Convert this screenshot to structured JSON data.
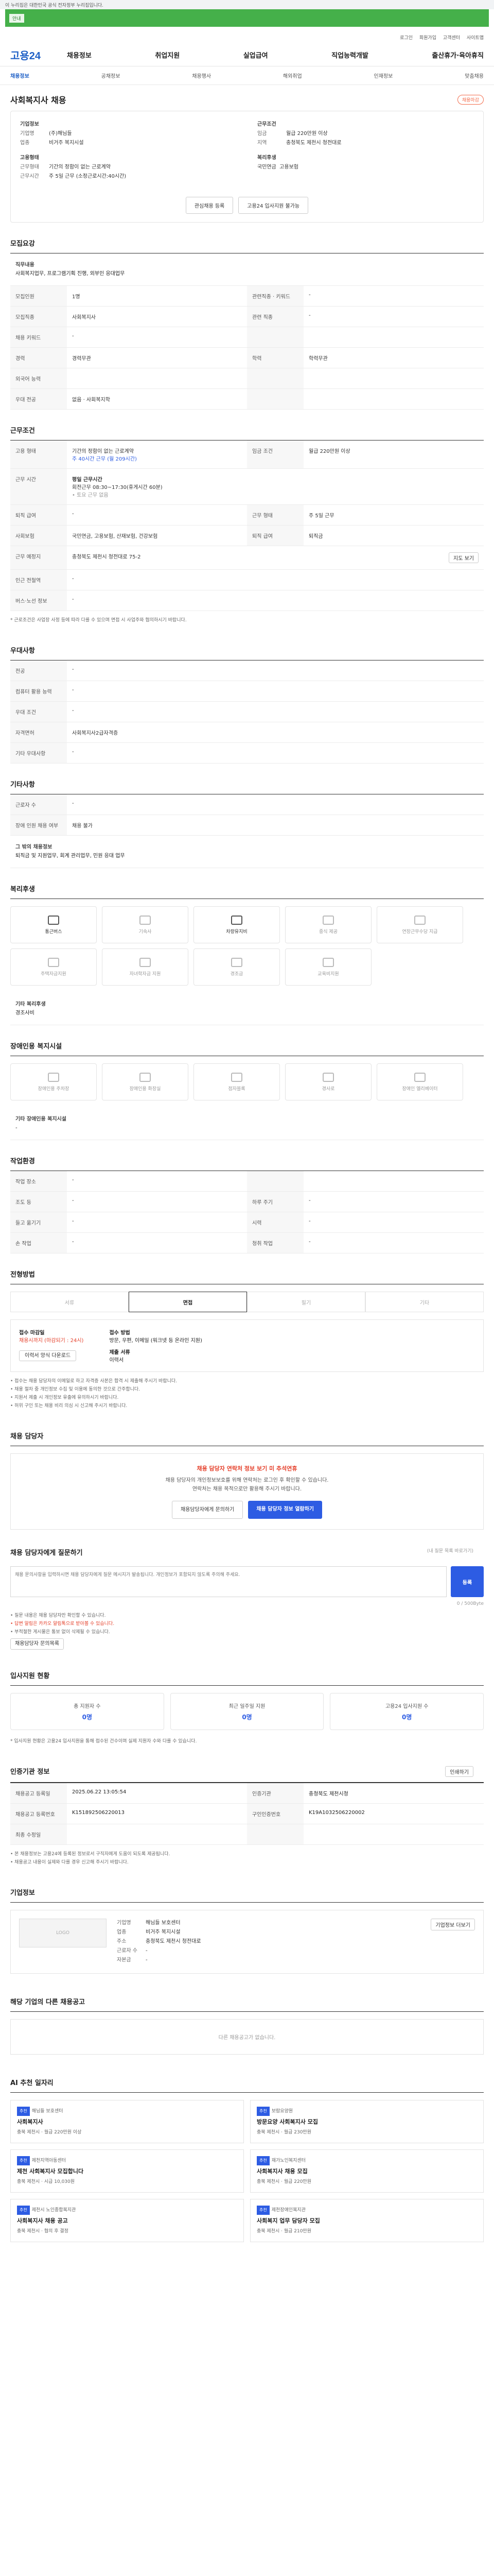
{
  "gov_banner": "이 누리집은 대한민국 공식 전자정부 누리집입니다.",
  "top_notice": "안내",
  "util_links": [
    "로그인",
    "회원가입",
    "고객센터",
    "사이트맵"
  ],
  "logo": "고용24",
  "gnb": [
    "채용정보",
    "취업지원",
    "실업급여",
    "직업능력개발",
    "출산휴가·육아휴직"
  ],
  "subnav": [
    "채용정보",
    "공채정보",
    "채용행사",
    "해외취업",
    "인재정보",
    "맞춤채용"
  ],
  "page_title": "사회복지사 채용",
  "badge": "채용마감",
  "company": {
    "h": "기업정보",
    "k1": "기업명",
    "v1": "(주)해님들",
    "k2": "업종",
    "v2": "비거주 복지시설",
    "h2": "근무조건",
    "k3": "임금",
    "v3": "월급 220만원 이상",
    "k4": "지역",
    "v4": "충청북도 제천시 청전대로",
    "h3": "고용형태",
    "k5": "근무형태",
    "v5": "기간의 정함이 없는 근로계약",
    "k6": "근무시간",
    "v6": "주 5일 근무 (소정근로시간:40시간)",
    "h4": "복리후생",
    "tags": [
      "국민연금",
      "고용보험"
    ]
  },
  "btn_interest": "관심채용 등록",
  "btn_apply": "고용24 입사지원 불가능",
  "recruit": {
    "title": "모집요강",
    "duty_h": "직무내용",
    "duty": "사회복지업무, 프로그램기획 진행, 외부인 응대업무",
    "rows": [
      [
        "모집인원",
        "1명",
        "관련직종 · 키워드",
        "-"
      ],
      [
        "모집직종",
        "사회복지사",
        "관련 직종",
        "-"
      ],
      [
        "채용 키워드",
        "-",
        "",
        ""
      ],
      [
        "경력",
        "경력무관",
        "학력",
        "학력무관"
      ],
      [
        "외국어 능력",
        "",
        "",
        ""
      ],
      [
        "우대 전공",
        "없음 · 사회복지학",
        "",
        ""
      ]
    ]
  },
  "work": {
    "title": "근무조건",
    "r1": [
      "고용 형태",
      "기간의 정함이 없는 근로계약",
      "임금 조건",
      "월급 220만원 이상"
    ],
    "r1b": "주 40시간 근무 (월 209시간)",
    "r2h": "근무 시간",
    "r2": [
      "평일 근무시간",
      "회전근무 08:30~17:30(휴게시간 60분)",
      "• 토요 근무 없음"
    ],
    "r3": [
      "퇴직 급여",
      "-",
      "근무 형태",
      "주 5일 근무"
    ],
    "r4": [
      "사회보험",
      "국민연금, 고용보험, 산재보험, 건강보험",
      "퇴직 급여",
      "퇴직금"
    ],
    "r5": [
      "근무 예정지",
      "충청북도 제천시 청전대로 75-2",
      "지도 보기"
    ],
    "r6": [
      "인근 전철역",
      "-",
      "",
      ""
    ],
    "r7": [
      "버스·노선 정보",
      "-",
      "",
      ""
    ],
    "note": "* 근로조건은 사업장 사정 등에 따라 다를 수 있으며 면접 시 사업주와 협의하시기 바랍니다."
  },
  "pref": {
    "title": "우대사항",
    "rows": [
      [
        "전공",
        "-"
      ],
      [
        "컴퓨터 활용 능력",
        "-"
      ],
      [
        "우대 조건",
        "-"
      ],
      [
        "자격면허",
        "사회복지사2급자격증"
      ],
      [
        "기타 우대사항",
        "-"
      ]
    ]
  },
  "etc": {
    "title": "기타사항",
    "rows": [
      [
        "근로자 수",
        "-"
      ],
      [
        "장애 인원 채용 여부",
        "채용 불가"
      ]
    ],
    "others_h": "그 밖의 채용정보",
    "others": "퇴직금 및 지원업무, 회계 관리업무, 민원 응대 업무"
  },
  "welfare": {
    "title": "복리후생",
    "items": [
      {
        "l": "통근버스",
        "on": true
      },
      {
        "l": "기숙사",
        "on": false
      },
      {
        "l": "차량유지비",
        "on": true
      },
      {
        "l": "중식 제공",
        "on": false
      },
      {
        "l": "연장근무수당 지급",
        "on": false
      },
      {
        "l": "주택자금지원",
        "on": false
      },
      {
        "l": "자녀학자금 지원",
        "on": false
      },
      {
        "l": "경조금",
        "on": false
      },
      {
        "l": "교육비지원",
        "on": false
      }
    ],
    "etc_h": "기타 복리후생",
    "etc": "경조사비"
  },
  "disability": {
    "title": "장애인용 복지시설",
    "items": [
      "장애인용 주차장",
      "장애인용 화장실",
      "점자블록",
      "경사로",
      "장애인 엘리베이터"
    ],
    "etc_h": "기타 장애인용 복지시설",
    "etc": "-"
  },
  "env": {
    "title": "작업환경",
    "rows": [
      [
        "작업 장소",
        "-",
        "",
        ""
      ],
      [
        "조도 등",
        "-",
        "하루 주기",
        "-"
      ],
      [
        "들고 옮기기",
        "-",
        "시력",
        "-"
      ],
      [
        "손 작업",
        "-",
        "청취 작업",
        "-"
      ]
    ]
  },
  "process": {
    "title": "전형방법",
    "steps": [
      "서류",
      "면접",
      "필기",
      "기타"
    ],
    "apply_h": "접수 마감일",
    "apply_v": "채용시까지 (마감되기 : 24시)",
    "method_h": "접수 방법",
    "method_v": "방문, 우편, 이메일 (워크넷 등 온라인 지원)",
    "docs_h": "제출 서류",
    "docs_v": "이력서",
    "btn_form": "이력서 양식 다운로드",
    "notes": [
      "• 접수는 채용 담당자의 이메일로 하고 자격증 사본은 합격 시 제출해 주시기 바랍니다.",
      "• 채용 절차 중 개인정보 수집 및 이용에 동의한 것으로 간주합니다.",
      "• 지원서 제출 시 개인정보 유출에 유의하시기 바랍니다.",
      "• 허위 구인 또는 채용 비리 의심 시 신고해 주시기 바랍니다."
    ]
  },
  "manager": {
    "title": "채용 담당자",
    "alert": "채용 담당자 연락처 정보 보기 미 추석연휴",
    "desc1": "채용 담당자의 개인정보보호를 위해 연락처는 로그인 후 확인할 수 있습니다.",
    "desc2": "연락처는 채용 목적으로만 활용해 주시기 바랍니다.",
    "btn1": "채용담당자에게 문의하기",
    "btn2": "채용 담당자 정보 열람하기"
  },
  "qa": {
    "title": "채용 담당자에게 질문하기",
    "hint": "(내 질문 목록 바로가기)",
    "placeholder": "채용 문의사항을 입력하시면 채용 담당자에게 질문 메시지가 발송됩니다. 개인정보가 포함되지 않도록 주의해 주세요.",
    "count": "0 / 500Byte",
    "btn": "등록",
    "notes": [
      "• 질문 내용은 채용 담당자만 확인할 수 있습니다.",
      "• 답변 알림은 카카오 알림톡으로 받아볼 수 있습니다.",
      "• 부적절한 게시물은 통보 없이 삭제될 수 있습니다."
    ],
    "btn_more": "채용담당자 문의목록"
  },
  "status": {
    "title": "입사지원 현황",
    "items": [
      [
        "총 지원자 수",
        "0명"
      ],
      [
        "최근 일주일 지원",
        "0명"
      ],
      [
        "고용24 입사지원 수",
        "0명"
      ]
    ],
    "note": "* 입사지원 현황은 고용24 입사지원을 통해 접수된 건수이며 실제 지원자 수와 다를 수 있습니다."
  },
  "info": {
    "title": "인증기관 정보",
    "btn_print": "인쇄하기",
    "rows": [
      [
        "채용공고 등록일",
        "2025.06.22 13:05:54",
        "인증기관",
        "충청북도 제천시청"
      ],
      [
        "채용공고 등록번호",
        "K151892506220013",
        "구인인증번호",
        "K19A1032506220002"
      ],
      [
        "최종 수정일",
        "",
        "",
        ""
      ]
    ],
    "notes": [
      "• 본 채용정보는 고용24에 등록된 정보로서 구직자에게 도움이 되도록 제공됩니다.",
      "• 채용공고 내용이 실제와 다를 경우 신고해 주시기 바랍니다."
    ]
  },
  "co": {
    "title": "기업정보",
    "logo": "LOGO",
    "rows": [
      [
        "기업명",
        "해님들 보호센터"
      ],
      [
        "업종",
        "비거주 복지시설"
      ],
      [
        "주소",
        "충청북도 제천시 청전대로"
      ],
      [
        "근로자 수",
        "-"
      ],
      [
        "자본금",
        "-"
      ]
    ],
    "btn": "기업정보 더보기"
  },
  "same": {
    "title": "해당 기업의 다른 채용공고",
    "empty": "다른 채용공고가 없습니다."
  },
  "recs": {
    "title": "AI 추천 일자리",
    "items": [
      {
        "tag": "추천",
        "c": "해님들 보호센터",
        "t": "사회복지사",
        "m": "충북 제천시 · 월급 220만원 이상"
      },
      {
        "tag": "추천",
        "c": "보람요양원",
        "t": "방문요양 사회복지사 모집",
        "m": "충북 제천시 · 월급 230만원"
      },
      {
        "tag": "추천",
        "c": "제천지역아동센터",
        "t": "제천 사회복지사 모집합니다",
        "m": "충북 제천시 · 시급 10,030원"
      },
      {
        "tag": "추천",
        "c": "재가노인복지센터",
        "t": "사회복지사 채용 모집",
        "m": "충북 제천시 · 월급 220만원"
      },
      {
        "tag": "추천",
        "c": "제천시 노인종합복지관",
        "t": "사회복지사 채용 공고",
        "m": "충북 제천시 · 협의 후 결정"
      },
      {
        "tag": "추천",
        "c": "제천장애인복지관",
        "t": "사회복지 업무 담당자 모집",
        "m": "충북 제천시 · 월급 210만원"
      }
    ]
  }
}
